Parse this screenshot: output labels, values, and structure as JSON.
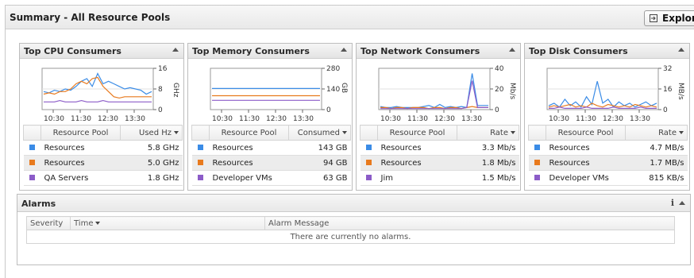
{
  "page": {
    "title": "Summary - All Resource Pools",
    "explore_label": "Explore"
  },
  "panels": [
    {
      "title": "Top CPU Consumers",
      "col_name": "Resource Pool",
      "col_value": "Used Hz",
      "rows": [
        {
          "name": "Resources",
          "value": "5.8 GHz"
        },
        {
          "name": "Resources",
          "value": "5.0 GHz"
        },
        {
          "name": "QA Servers",
          "value": "1.8 GHz"
        }
      ],
      "chart": {
        "times": [
          "10:30",
          "11:30",
          "12:30",
          "13:30"
        ],
        "y_ticks": [
          "16",
          "8",
          "0"
        ],
        "unit": "GHz",
        "ymax": 16,
        "series": [
          {
            "color": "#3b8ce6",
            "values": [
              7,
              6.5,
              7.5,
              7,
              8,
              7.5,
              9,
              11,
              12,
              9,
              14,
              10,
              11,
              10,
              9,
              8,
              8.5,
              8,
              7.5,
              6,
              7
            ]
          },
          {
            "color": "#e87a1e",
            "values": [
              6,
              6.5,
              6,
              7,
              7,
              8,
              10,
              11,
              10,
              12,
              12.5,
              9,
              7,
              5,
              4.5,
              5,
              5,
              5,
              5,
              5,
              5
            ]
          },
          {
            "color": "#8c5cc8",
            "values": [
              3,
              3,
              3,
              3.5,
              3,
              3,
              3,
              3.5,
              3,
              3,
              3,
              3.5,
              3,
              3,
              3,
              3,
              3,
              3,
              3,
              3,
              3
            ]
          }
        ]
      }
    },
    {
      "title": "Top Memory Consumers",
      "col_name": "Resource Pool",
      "col_value": "Consumed",
      "rows": [
        {
          "name": "Resources",
          "value": "143 GB"
        },
        {
          "name": "Resources",
          "value": "94 GB"
        },
        {
          "name": "Developer VMs",
          "value": "63 GB"
        }
      ],
      "chart": {
        "times": [
          "10:30",
          "11:30",
          "12:30",
          "13:30"
        ],
        "y_ticks": [
          "280",
          "140",
          "0"
        ],
        "unit": "GB",
        "ymax": 280,
        "series": [
          {
            "color": "#3b8ce6",
            "values": [
              143,
              143,
              143,
              143,
              143,
              143,
              143,
              143,
              143,
              143,
              143,
              143,
              143,
              143,
              143,
              143,
              143,
              143,
              143,
              143,
              143
            ]
          },
          {
            "color": "#e87a1e",
            "values": [
              94,
              94,
              94,
              94,
              94,
              94,
              94,
              94,
              94,
              94,
              94,
              94,
              94,
              94,
              94,
              94,
              94,
              94,
              94,
              94,
              94
            ]
          },
          {
            "color": "#8c5cc8",
            "values": [
              63,
              63,
              63,
              63,
              63,
              63,
              63,
              63,
              63,
              63,
              63,
              63,
              63,
              63,
              63,
              63,
              63,
              63,
              63,
              63,
              63
            ]
          }
        ]
      }
    },
    {
      "title": "Top Network Consumers",
      "col_name": "Resource Pool",
      "col_value": "Rate",
      "rows": [
        {
          "name": "Resources",
          "value": "3.3 Mb/s"
        },
        {
          "name": "Resources",
          "value": "1.8 Mb/s"
        },
        {
          "name": "Jim",
          "value": "1.5 Mb/s"
        }
      ],
      "chart": {
        "times": [
          "10:30",
          "11:30",
          "12:30",
          "13:30"
        ],
        "y_ticks": [
          "40",
          "20",
          "0"
        ],
        "unit": "Mb/s",
        "ymax": 40,
        "series": [
          {
            "color": "#3b8ce6",
            "values": [
              3,
              2,
              2,
              3,
              2,
              2,
              2,
              2,
              3,
              4,
              2,
              5,
              2,
              3,
              2,
              3,
              2,
              35,
              4,
              4,
              4
            ]
          },
          {
            "color": "#e87a1e",
            "values": [
              2,
              2,
              1,
              2,
              2,
              1,
              2,
              2,
              2,
              1,
              2,
              2,
              1,
              2,
              2,
              1,
              2,
              3,
              2,
              2,
              2
            ]
          },
          {
            "color": "#8c5cc8",
            "values": [
              1,
              1,
              1,
              1,
              1,
              1,
              1,
              1,
              1,
              1,
              1,
              1,
              1,
              1,
              1,
              1,
              2,
              28,
              2,
              2,
              2
            ]
          }
        ]
      }
    },
    {
      "title": "Top Disk Consumers",
      "col_name": "Resource Pool",
      "col_value": "Rate",
      "rows": [
        {
          "name": "Resources",
          "value": "4.7 MB/s"
        },
        {
          "name": "Resources",
          "value": "1.7 MB/s"
        },
        {
          "name": "Developer VMs",
          "value": "815 KB/s"
        }
      ],
      "chart": {
        "times": [
          "10:30",
          "11:30",
          "12:30",
          "13:30"
        ],
        "y_ticks": [
          "32",
          "16",
          "0"
        ],
        "unit": "MB/s",
        "ymax": 32,
        "series": [
          {
            "color": "#3b8ce6",
            "values": [
              3,
              5,
              2,
              8,
              3,
              6,
              2,
              10,
              4,
              22,
              5,
              8,
              2,
              6,
              3,
              5,
              2,
              4,
              6,
              3,
              5
            ]
          },
          {
            "color": "#e87a1e",
            "values": [
              2,
              3,
              2,
              3,
              4,
              2,
              3,
              2,
              5,
              3,
              2,
              4,
              3,
              2,
              3,
              2,
              4,
              3,
              2,
              3,
              2
            ]
          },
          {
            "color": "#8c5cc8",
            "values": [
              1,
              1,
              2,
              1,
              1,
              1,
              1,
              2,
              1,
              1,
              1,
              1,
              2,
              1,
              1,
              1,
              1,
              2,
              1,
              1,
              1
            ]
          }
        ]
      }
    }
  ],
  "alarms": {
    "title": "Alarms",
    "col_severity": "Severity",
    "col_time": "Time",
    "col_message": "Alarm Message",
    "empty_text": "There are currently no alarms."
  },
  "colors": {
    "blue": "#3b8ce6",
    "orange": "#e87a1e",
    "purple": "#8c5cc8"
  },
  "icons": {
    "explore": "explore-icon",
    "collapse": "chevron-up-icon",
    "info": "info-icon",
    "sort": "sort-down-icon"
  }
}
